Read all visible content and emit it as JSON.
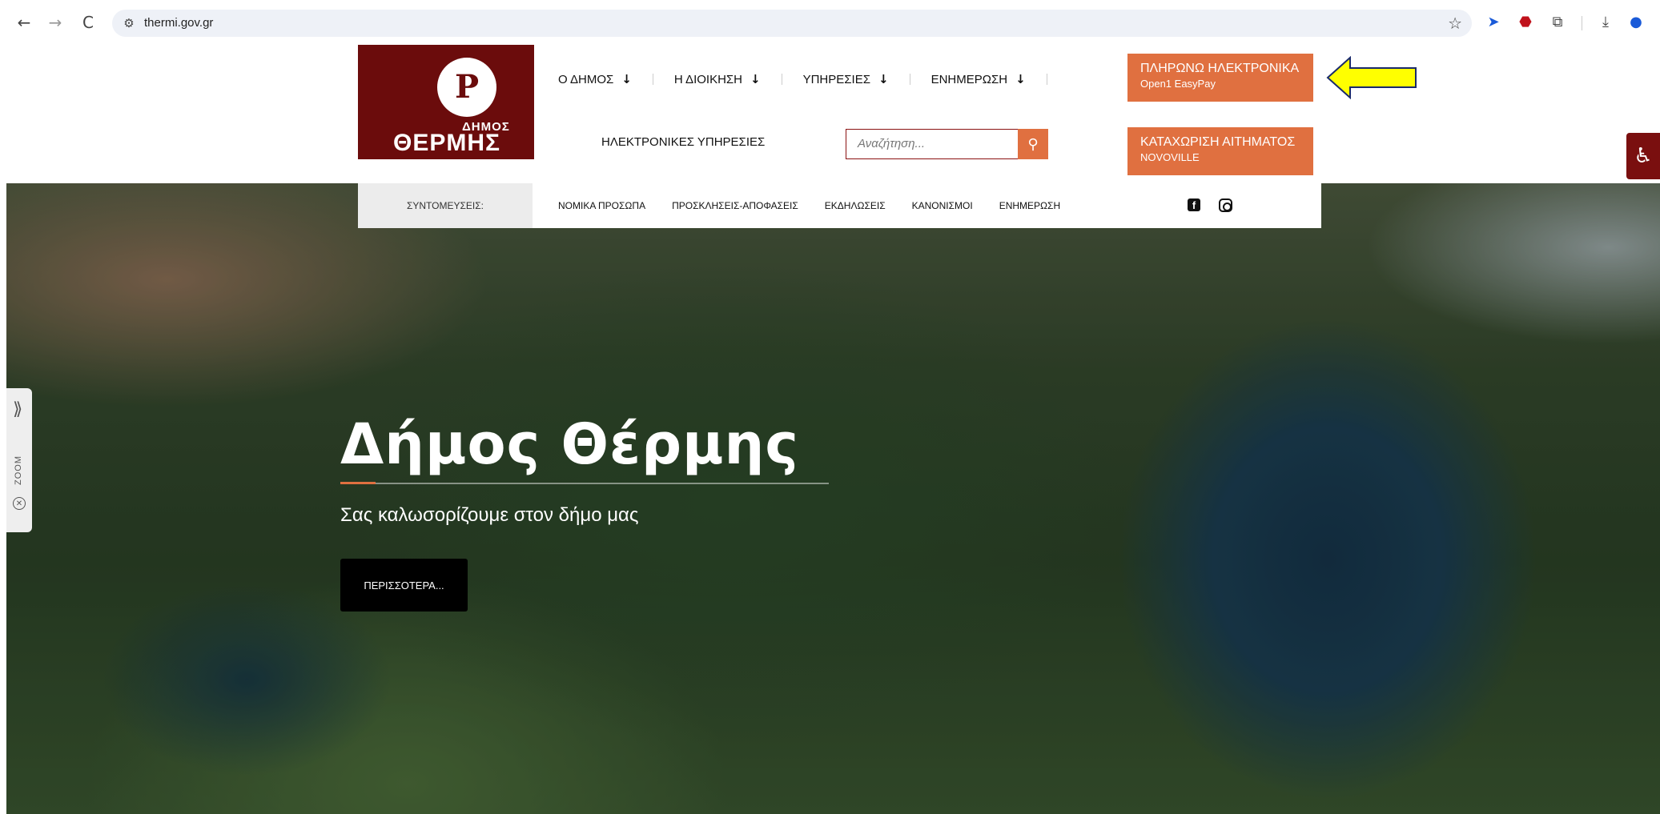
{
  "browser": {
    "back_icon": "←",
    "forward_icon": "→",
    "reload_icon": "C",
    "url": "thermi.gov.gr",
    "star_icon": "☆"
  },
  "logo": {
    "small_text": "ΔΗΜΟΣ",
    "big_text": "ΘΕΡΜΗΣ",
    "emblem_glyph": "Ρ"
  },
  "nav": {
    "items": [
      {
        "label": "Ο ΔΗΜΟΣ"
      },
      {
        "label": "Η ΔΙΟΙΚΗΣΗ"
      },
      {
        "label": "ΥΠΗΡΕΣΙΕΣ"
      },
      {
        "label": "ΕΝΗΜΕΡΩΣΗ"
      }
    ],
    "arrow": "↓",
    "eservices_label": "ΗΛΕΚΤΡΟΝΙΚΕΣ ΥΠΗΡΕΣΙΕΣ"
  },
  "search": {
    "placeholder": "Αναζήτηση..."
  },
  "cta": {
    "pay": {
      "title": "ΠΛΗΡΩΝΩ ΗΛΕΚΤΡΟΝΙΚΑ",
      "subtitle": "Open1 EasyPay"
    },
    "request": {
      "title": "ΚΑΤΑΧΩΡΙΣΗ ΑΙΤΗΜΑΤΟΣ",
      "subtitle": "NOVOVILLE"
    }
  },
  "shortcuts": {
    "label": "ΣΥΝΤΟΜΕΥΣΕΙΣ:",
    "links": [
      "ΝΟΜΙΚΑ ΠΡΟΣΩΠΑ",
      "ΠΡΟΣΚΛΗΣΕΙΣ-ΑΠΟΦΑΣΕΙΣ",
      "ΕΚΔΗΛΩΣΕΙΣ",
      "ΚΑΝΟΝΙΣΜΟΙ",
      "ΕΝΗΜΕΡΩΣΗ"
    ],
    "facebook_glyph": "f"
  },
  "hero": {
    "title": "Δήμος Θέρμης",
    "subtitle": "Σας καλωσορίζουμε στον δήμο μας",
    "button_label": "ΠΕΡΙΣΣΟΤΕΡΑ..."
  },
  "zoom_widget": {
    "label": "ZOOM",
    "chevron": "⟫",
    "close": "✕"
  },
  "colors": {
    "brand": "#6b0c0c",
    "accent": "#e07040",
    "arrow": "#ffff00"
  }
}
